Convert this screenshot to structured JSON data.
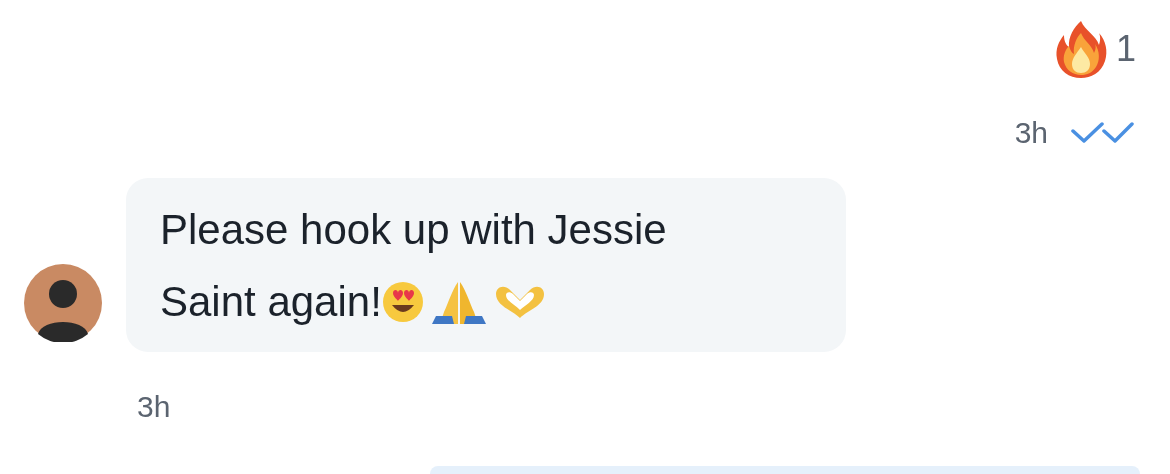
{
  "reaction": {
    "count": "1"
  },
  "sent_meta": {
    "time": "3h",
    "read": true
  },
  "incoming_message": {
    "lines": [
      "Please hook up with Jessie",
      "Saint again!"
    ],
    "time": "3h"
  }
}
